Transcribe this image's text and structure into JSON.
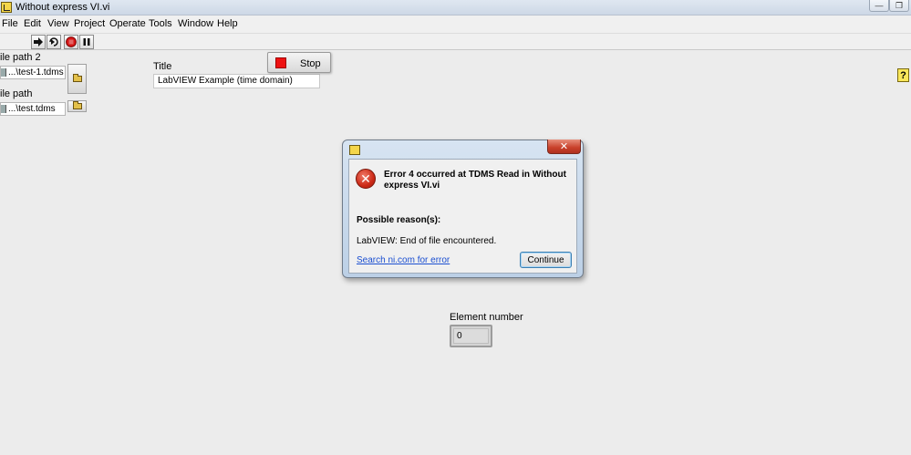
{
  "window": {
    "title": "Without express VI.vi",
    "minimize_glyph": "—",
    "restore_glyph": "❐"
  },
  "menu": {
    "items": [
      "File",
      "Edit",
      "View",
      "Project",
      "Operate",
      "Tools",
      "Window",
      "Help"
    ]
  },
  "toolbar": {
    "run_icon": "run-arrow-icon",
    "run_continuous_icon": "run-continuously-icon",
    "abort_icon": "abort-execution-icon",
    "pause_icon": "pause-icon",
    "help_glyph": "?"
  },
  "front_panel": {
    "file_path_2": {
      "label": "ile path 2",
      "value": "...\\test-1.tdms"
    },
    "file_path": {
      "label": "ile path",
      "value": "...\\test.tdms"
    },
    "title": {
      "label": "Title",
      "value": "LabVIEW Example (time domain)"
    },
    "stop_button": {
      "label": "Stop",
      "color": "#ee1111"
    },
    "element_number": {
      "label": "Element number",
      "value": "0"
    }
  },
  "dialog": {
    "close_glyph": "✕",
    "error_glyph": "✕",
    "heading": "Error 4 occurred at TDMS Read in Without express VI.vi",
    "reason_heading": "Possible reason(s):",
    "reason_text": "LabVIEW:  End of file encountered.",
    "search_link": "Search ni.com for error",
    "continue_label": "Continue"
  },
  "colors": {
    "link": "#1b4fd1",
    "error_red": "#cc2a17"
  }
}
